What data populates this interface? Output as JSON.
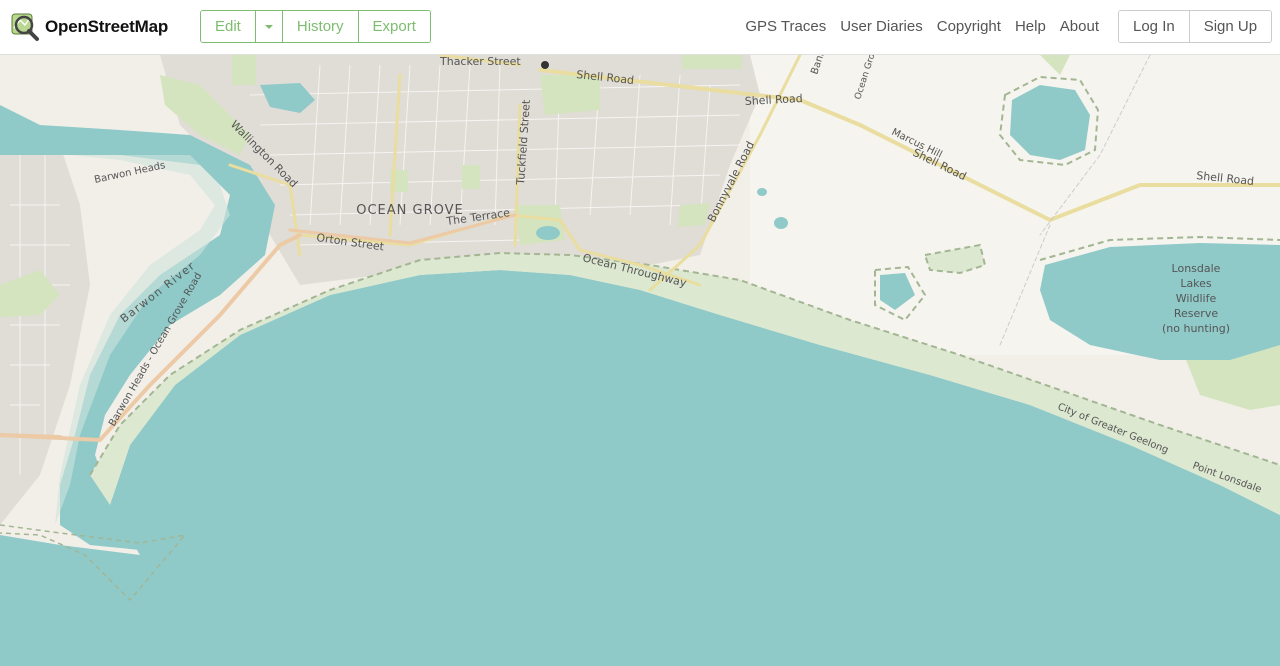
{
  "header": {
    "logo_text": "OpenStreetMap",
    "edit_label": "Edit",
    "history_label": "History",
    "export_label": "Export",
    "nav": [
      "GPS Traces",
      "User Diaries",
      "Copyright",
      "Help",
      "About"
    ],
    "login_label": "Log In",
    "signup_label": "Sign Up"
  },
  "map": {
    "town": "OCEAN GROVE",
    "roads": {
      "thacker": "Thacker Street",
      "shell1": "Shell Road",
      "shell2": "Shell Road",
      "shell3": "Shell Road",
      "shell4": "Shell Road",
      "tuckfield": "Tuckfield Street",
      "wallington": "Wallington Road",
      "orton": "Orton Street",
      "terrace": "The Terrace",
      "throughway": "Ocean Throughway",
      "bonnyvale": "Bonnyvale Road",
      "barwon_heads_rd": "Barwon Heads - Ocean Grove Road",
      "marcus_hill": "Marcus Hill",
      "ocean_grove_small": "Ocean Grove",
      "bank": "Bank"
    },
    "places": {
      "barwon_heads": "Barwon Heads",
      "barwon_river": "Barwon River",
      "greater_geelong": "City of Greater Geelong",
      "point_lonsdale": "Point Lonsdale",
      "reserve": [
        "Lonsdale",
        "Lakes",
        "Wildlife",
        "Reserve",
        "(no hunting)"
      ]
    },
    "colors": {
      "water": "#8fcac9",
      "land": "#f2efe9",
      "urban": "#e0dcd6",
      "park": "#d4e4bf",
      "dune": "#dde8d0",
      "road_primary": "#e9dd9f",
      "road_secondary": "#eccaa6",
      "boundary": "#a3b694"
    }
  }
}
